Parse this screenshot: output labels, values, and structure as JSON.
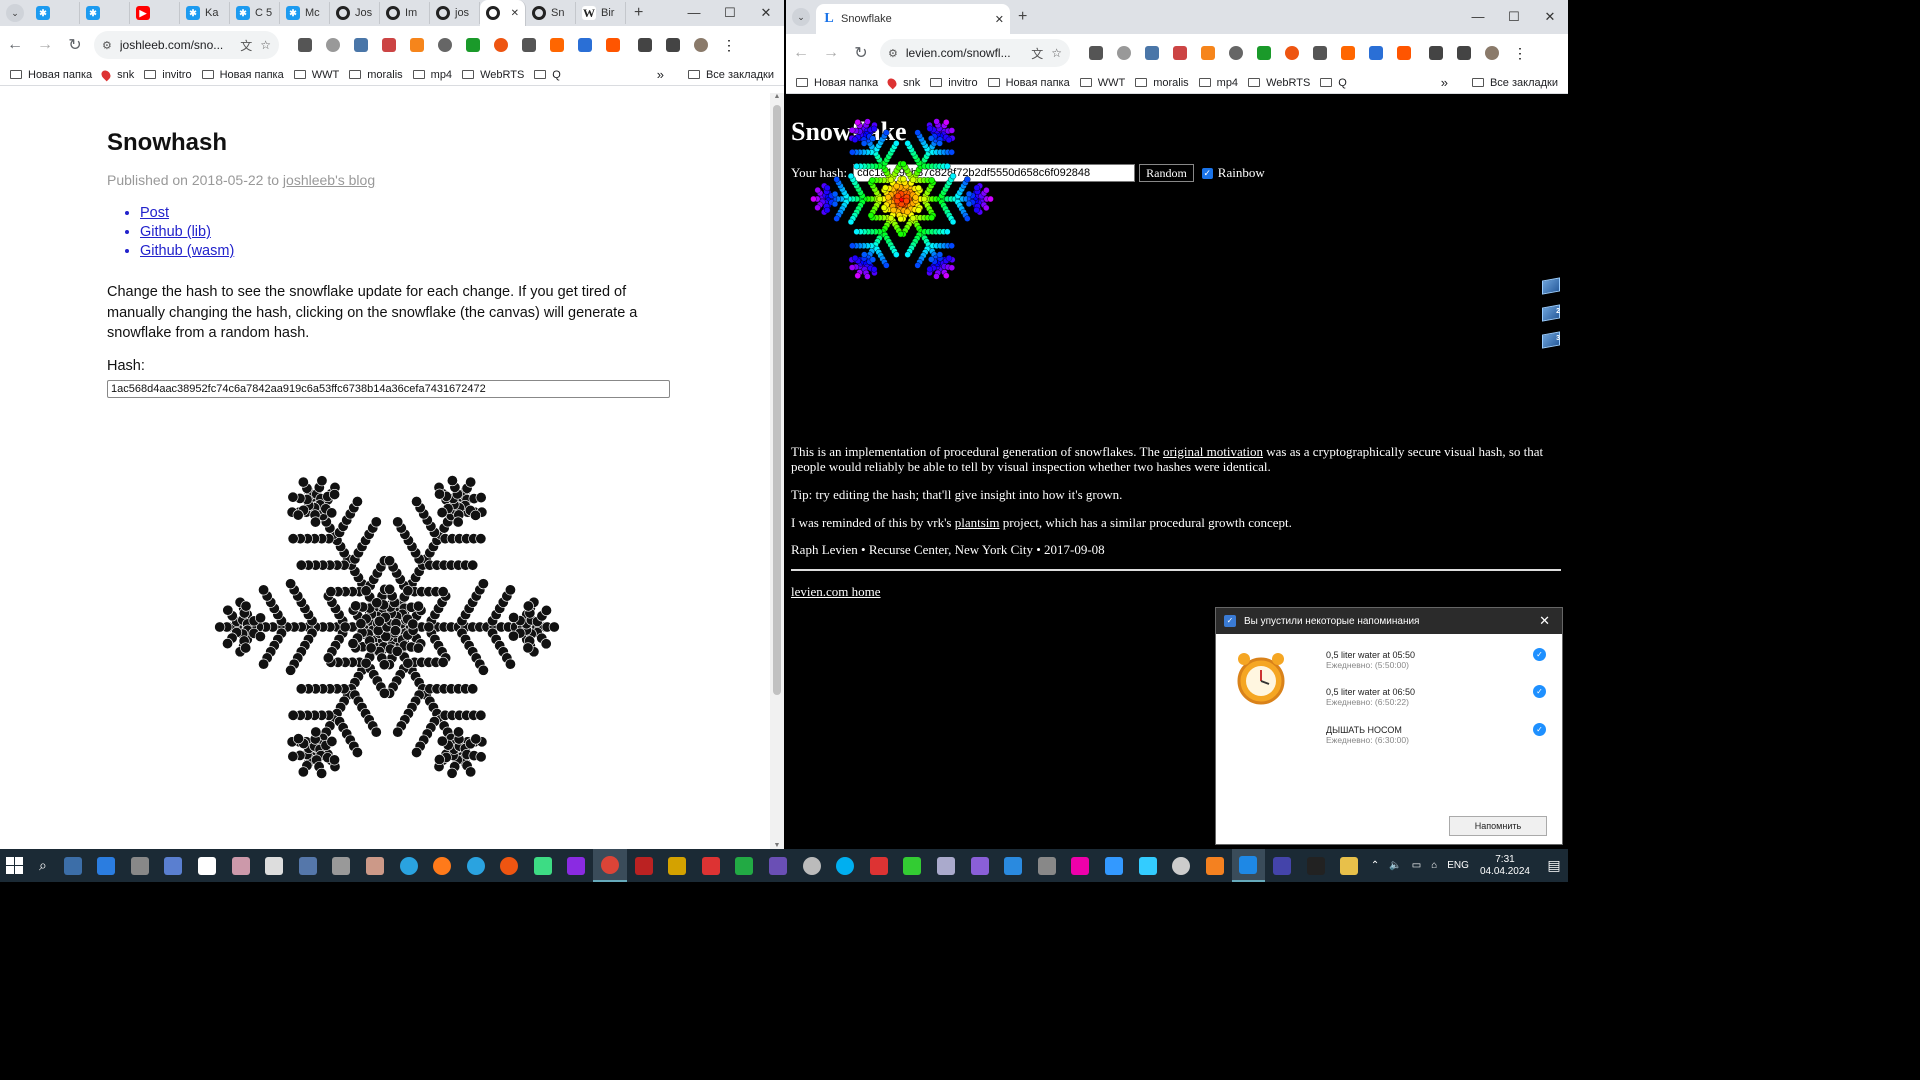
{
  "left_window": {
    "tabs": [
      {
        "icon": "bluesky-icon",
        "color": "#1d9bf0",
        "label": ""
      },
      {
        "icon": "bluesky-icon",
        "color": "#1d9bf0",
        "label": ""
      },
      {
        "icon": "youtube-icon",
        "color": "#ff0000",
        "label": ""
      },
      {
        "icon": "bluesky-icon",
        "color": "#1d9bf0",
        "label": "Ka"
      },
      {
        "icon": "bluesky-icon",
        "color": "#1d9bf0",
        "label": "C 5"
      },
      {
        "icon": "bluesky-icon",
        "color": "#1d9bf0",
        "label": "Mc"
      },
      {
        "icon": "github-icon",
        "color": "#222222",
        "label": "Jos"
      },
      {
        "icon": "github-icon",
        "color": "#222222",
        "label": "Im"
      },
      {
        "icon": "github-icon",
        "color": "#222222",
        "label": "jos"
      },
      {
        "icon": "github-icon",
        "color": "#222222",
        "label": ""
      },
      {
        "icon": "github-icon",
        "color": "#222222",
        "label": "Sn"
      },
      {
        "icon": "wikipedia-icon",
        "color": "#555555",
        "label": "Bir"
      }
    ],
    "url": "joshleeb.com/sno...",
    "bookmarks": [
      "Новая папка",
      "snk",
      "invitro",
      "Новая папка",
      "WWT",
      "moralis",
      "mp4",
      "WebRTS",
      "Q"
    ],
    "all_bookmarks": "Все закладки",
    "page": {
      "title": "Snowhash",
      "published_prefix": "Published on 2018-05-22 to ",
      "published_link": "joshleeb's blog",
      "links": [
        "Post",
        "Github (lib)",
        "Github (wasm)"
      ],
      "intro": "Change the hash to see the snowflake update for each change. If you get tired of manually changing the hash, clicking on the snowflake (the canvas) will generate a snowflake from a random hash.",
      "hash_label": "Hash:",
      "hash_value": "1ac568d4aac38952fc74c6a7842aa919c6a53ffc6738b14a36cefa7431672472"
    }
  },
  "right_window": {
    "tab_title": "Snowflake",
    "url": "levien.com/snowfl...",
    "bookmarks": [
      "Новая папка",
      "snk",
      "invitro",
      "Новая папка",
      "WWT",
      "moralis",
      "mp4",
      "WebRTS",
      "Q"
    ],
    "all_bookmarks": "Все закладки",
    "page": {
      "title": "Snowflake",
      "hash_label": "Your hash:",
      "hash_value": "cdc1a1a98b37c828f72b2df5550d658c6f092848",
      "random_button": "Random",
      "rainbow_label": "Rainbow",
      "rainbow_checked": true,
      "para1_a": "This is an implementation of procedural generation of snowflakes. The ",
      "para1_link": "original motivation",
      "para1_b": " was as a cryptographically secure visual hash, so that people would reliably be able to tell by visual inspection whether two hashes were identical.",
      "para2": "Tip: try editing the hash; that'll give insight into how it's grown.",
      "para3_a": "I was reminded of this by vrk's ",
      "para3_link": "plantsim",
      "para3_b": " project, which has a similar procedural growth concept.",
      "para4": "Raph Levien • Recurse Center, New York City • 2017-09-08",
      "home_link": "levien.com home"
    }
  },
  "reminder": {
    "header": "Вы упустили некоторые напоминания",
    "items": [
      {
        "title": "0,5 liter water at 05:50",
        "sub": "Ежедневно: (5:50:00)"
      },
      {
        "title": "0,5 liter water at 06:50",
        "sub": "Ежедневно: (6:50:22)"
      },
      {
        "title": "ДЫШАТЬ НОСОМ",
        "sub": "Ежедневно: (6:30:00)"
      }
    ],
    "button": "Напомнить"
  },
  "taskbar": {
    "lang": "ENG",
    "time": "7:31",
    "date": "04.04.2024"
  }
}
